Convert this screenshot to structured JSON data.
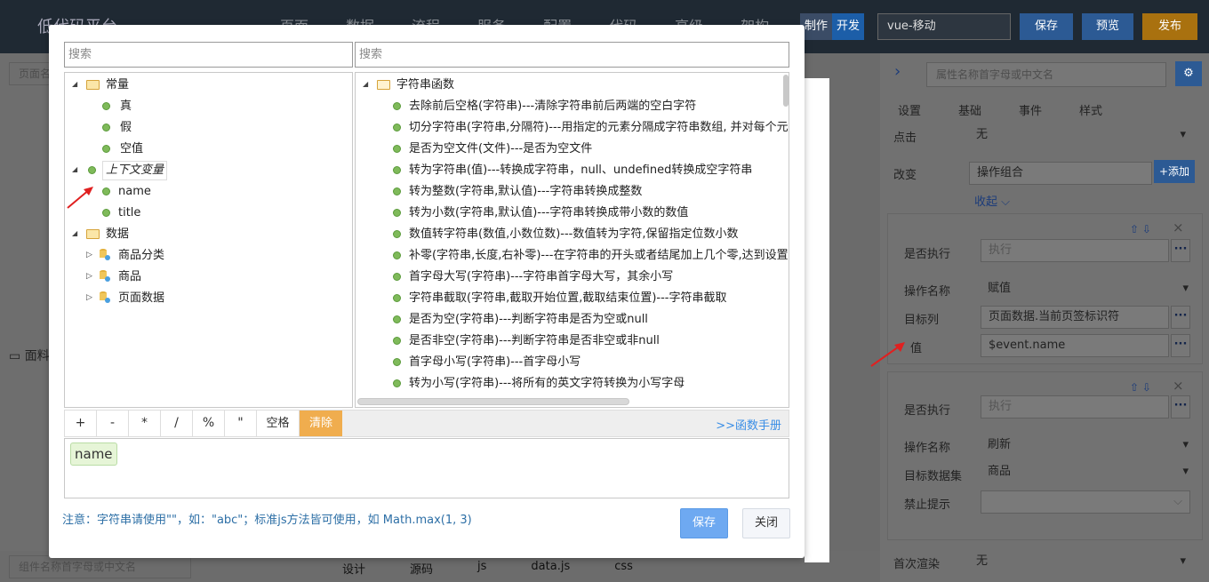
{
  "topbar": {
    "brand": "低代码平台",
    "nav": [
      "页面",
      "数据",
      "流程",
      "服务",
      "配置",
      "代码",
      "高级",
      "架构"
    ],
    "mode_make": "制作",
    "mode_dev": "开发",
    "platform": "vue-移动",
    "save": "保存",
    "preview": "预览",
    "publish": "发布"
  },
  "left": {
    "search": "页面名",
    "bottom_search": "组件名称首字母或中文名",
    "folder_label": "面料"
  },
  "bottom_tabs": [
    "设计",
    "源码",
    "js",
    "data.js",
    "css"
  ],
  "right": {
    "search_placeholder": "属性名称首字母或中文名",
    "tabs": [
      "设置",
      "基础",
      "事件",
      "样式"
    ],
    "click_label": "点击",
    "click_value": "无",
    "change_label": "改变",
    "change_value": "操作组合",
    "add": "+添加",
    "collapse": "收起",
    "card1": {
      "exec_label": "是否执行",
      "exec_placeholder": "执行",
      "op_label": "操作名称",
      "op_value": "赋值",
      "target_label": "目标列",
      "target_value": "页面数据.当前页签标识符",
      "value_label": "值",
      "value_value": "$event.name"
    },
    "card2": {
      "exec_label": "是否执行",
      "exec_placeholder": "执行",
      "op_label": "操作名称",
      "op_value": "刷新",
      "dataset_label": "目标数据集",
      "dataset_value": "商品",
      "prompt_label": "禁止提示"
    },
    "first_render_label": "首次渲染",
    "first_render_value": "无"
  },
  "dialog": {
    "search_left": "搜索",
    "search_right": "搜索",
    "left_tree": {
      "constants": "常量",
      "true": "真",
      "false": "假",
      "null": "空值",
      "context": "上下文变量",
      "name": "name",
      "title": "title",
      "data": "数据",
      "category": "商品分类",
      "goods": "商品",
      "page_data": "页面数据"
    },
    "right_tree": {
      "root": "字符串函数",
      "items": [
        "去除前后空格(字符串)---清除字符串前后两端的空白字符",
        "切分字符串(字符串,分隔符)---用指定的元素分隔成字符串数组, 并对每个元素进行处理",
        "是否为空文件(文件)---是否为空文件",
        "转为字符串(值)---转换成字符串，null、undefined转换成空字符串",
        "转为整数(字符串,默认值)---字符串转换成整数",
        "转为小数(字符串,默认值)---字符串转换成带小数的数值",
        "数值转字符串(数值,小数位数)---数值转为字符,保留指定位数小数",
        "补零(字符串,长度,右补零)---在字符串的开头或者结尾加上几个零,达到设置的长度",
        "首字母大写(字符串)---字符串首字母大写，其余小写",
        "字符串截取(字符串,截取开始位置,截取结束位置)---字符串截取",
        "是否为空(字符串)---判断字符串是否为空或null",
        "是否非空(字符串)---判断字符串是否非空或非null",
        "首字母小写(字符串)---首字母小写",
        "转为小写(字符串)---将所有的英文字符转换为小写字母"
      ]
    },
    "ops": [
      "+",
      "-",
      "*",
      "/",
      "%",
      "\"",
      "空格"
    ],
    "clear": "清除",
    "manual": ">>函数手册",
    "expression_chip": "name",
    "note": "注意：字符串请使用\"\"，如：\"abc\"；标准js方法皆可使用，如 Math.max(1, 3)",
    "save": "保存",
    "close": "关闭"
  },
  "colors": {
    "accent_blue": "#6ea9f1",
    "clear_orange": "#f0ad4e",
    "node_green": "#7fba5a",
    "arrow_red": "#e02020"
  }
}
